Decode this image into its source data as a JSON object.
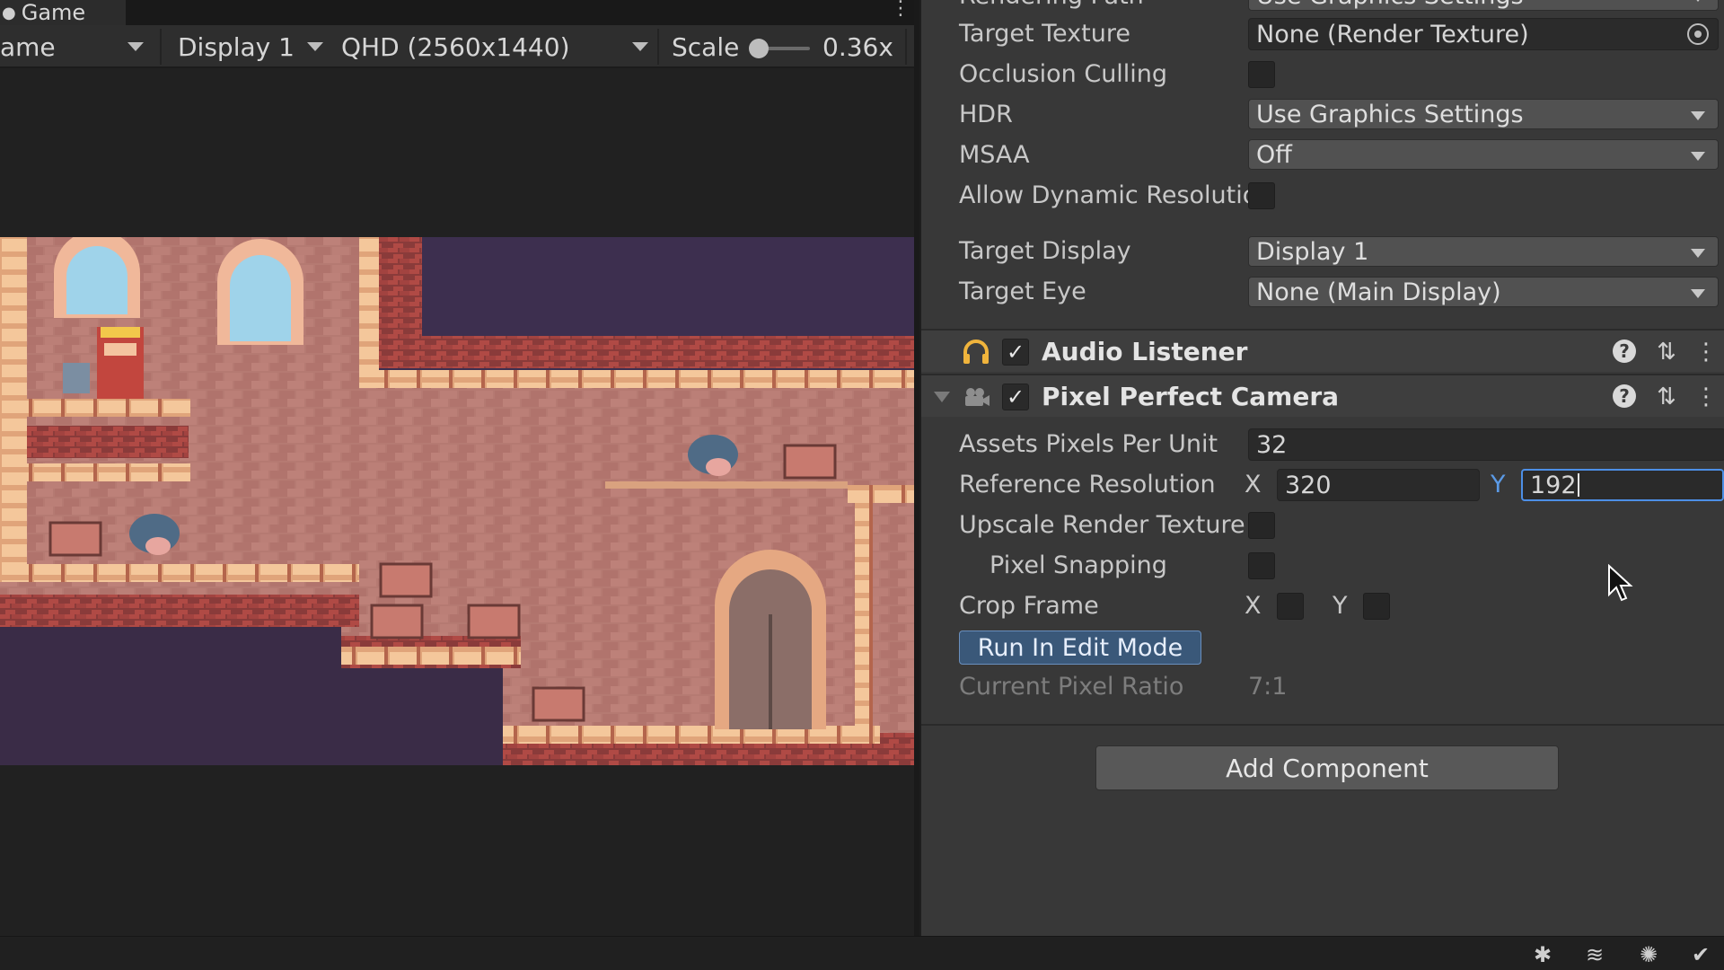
{
  "game_view": {
    "tab_title": "Game",
    "game_dropdown": "ame",
    "display_dropdown": "Display 1",
    "resolution_dropdown": "QHD (2560x1440)",
    "scale_label": "Scale",
    "scale_value": "0.36x"
  },
  "inspector": {
    "camera": {
      "rendering_path_label": "Rendering Path",
      "rendering_path_value": "Use Graphics Settings",
      "target_texture_label": "Target Texture",
      "target_texture_value": "None (Render Texture)",
      "occlusion_culling_label": "Occlusion Culling",
      "occlusion_culling_checked": false,
      "hdr_label": "HDR",
      "hdr_value": "Use Graphics Settings",
      "msaa_label": "MSAA",
      "msaa_value": "Off",
      "dynamic_resolution_label": "Allow Dynamic Resolutio",
      "dynamic_resolution_checked": false,
      "target_display_label": "Target Display",
      "target_display_value": "Display 1",
      "target_eye_label": "Target Eye",
      "target_eye_value": "None (Main Display)"
    },
    "audio_listener": {
      "title": "Audio Listener",
      "enabled": true
    },
    "pixel_perfect_camera": {
      "title": "Pixel Perfect Camera",
      "enabled": true,
      "assets_ppu_label": "Assets Pixels Per Unit",
      "assets_ppu_value": "32",
      "reference_resolution_label": "Reference Resolution",
      "ref_x_label": "X",
      "ref_x_value": "320",
      "ref_y_label": "Y",
      "ref_y_value": "192",
      "upscale_rt_label": "Upscale Render Texture",
      "upscale_rt_checked": false,
      "pixel_snapping_label": "Pixel Snapping",
      "pixel_snapping_checked": false,
      "crop_frame_label": "Crop Frame",
      "crop_x_label": "X",
      "crop_y_label": "Y",
      "run_in_edit_mode_label": "Run In Edit Mode",
      "current_pixel_ratio_label": "Current Pixel Ratio",
      "current_pixel_ratio_value": "7:1"
    },
    "add_component_label": "Add Component"
  },
  "colors": {
    "accent_blue": "#3a5879",
    "active_field_border": "#4d8fe6",
    "audio_icon": "#f0b43c",
    "brick": "#b97b74",
    "sky_back": "#3d2f4f"
  }
}
